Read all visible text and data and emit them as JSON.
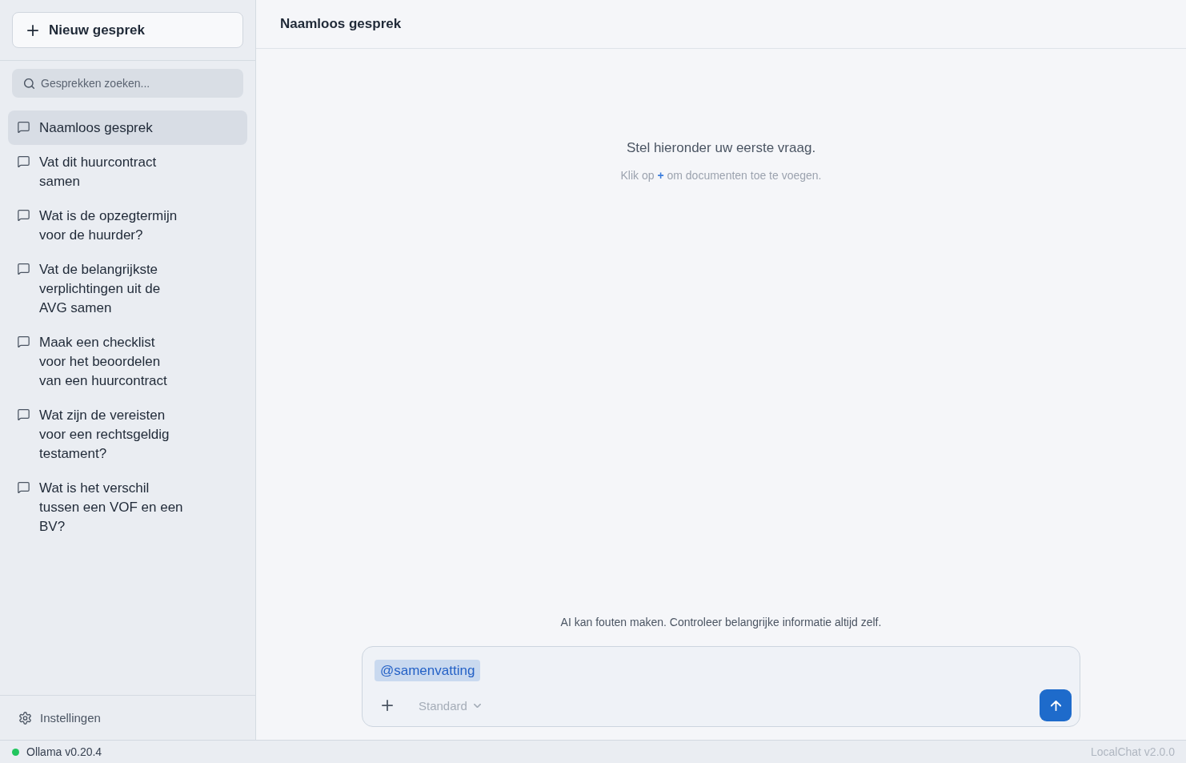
{
  "sidebar": {
    "new_chat_button": {
      "label": "Nieuw gesprek"
    },
    "search": {
      "placeholder": "Gesprekken zoeken..."
    },
    "conversations": [
      {
        "title": "Naamloos gesprek",
        "selected": true
      },
      {
        "title": "Vat dit huurcontract samen",
        "selected": false
      },
      {
        "title": "Wat is de opzegtermijn voor de huurder?",
        "selected": false
      },
      {
        "title": "Vat de belangrijkste verplichtingen uit de AVG samen",
        "selected": false
      },
      {
        "title": "Maak een checklist voor het beoordelen van een huurcontract",
        "selected": false
      },
      {
        "title": "Wat zijn de vereisten voor een rechtsgeldig testament?",
        "selected": false
      },
      {
        "title": "Wat is het verschil tussen een VOF en een BV?",
        "selected": false
      }
    ],
    "settings": {
      "label": "Instellingen"
    }
  },
  "header": {
    "title": "Naamloos gesprek"
  },
  "empty_state": {
    "prompt": "Stel hieronder uw eerste vraag.",
    "hint": "Klik op **+** om documenten toe te voegen."
  },
  "disclaimer": "AI kan fouten maken. Controleer belangrijke informatie altijd zelf.",
  "composer": {
    "mention": "@samenvatting",
    "model": "Standard"
  },
  "status_bar": {
    "backend": {
      "label": "Ollama v0.20.4",
      "connected": true
    },
    "version": "LocalChat v2.0.0"
  }
}
